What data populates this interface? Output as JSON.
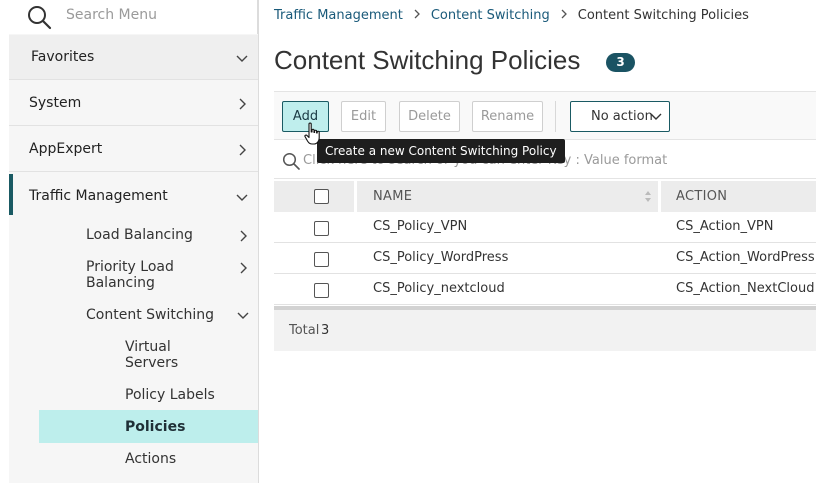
{
  "sidebar": {
    "search_placeholder": "Search Menu",
    "items": {
      "favorites": "Favorites",
      "system": "System",
      "appexpert": "AppExpert",
      "traffic_management": "Traffic Management"
    },
    "traffic_management_children": {
      "load_balancing": "Load Balancing",
      "priority_load_balancing": "Priority Load Balancing",
      "content_switching": "Content Switching"
    },
    "content_switching_children": {
      "virtual_servers": "Virtual Servers",
      "policy_labels": "Policy Labels",
      "policies": "Policies",
      "actions": "Actions"
    },
    "selected": "Policies"
  },
  "breadcrumb": {
    "items": [
      "Traffic Management",
      "Content Switching",
      "Content Switching Policies"
    ]
  },
  "page": {
    "title": "Content Switching Policies",
    "count": "3"
  },
  "toolbar": {
    "add": "Add",
    "edit": "Edit",
    "delete": "Delete",
    "rename": "Rename",
    "action_select": "No action"
  },
  "tooltip": "Create a new Content Switching Policy",
  "filter": {
    "placeholder": "Click here to search or you can enter Key : Value format"
  },
  "table": {
    "columns": [
      "NAME",
      "ACTION"
    ],
    "rows": [
      {
        "name": "CS_Policy_VPN",
        "action": "CS_Action_VPN"
      },
      {
        "name": "CS_Policy_WordPress",
        "action": "CS_Action_WordPress"
      },
      {
        "name": "CS_Policy_nextcloud",
        "action": "CS_Action_NextCloud"
      }
    ]
  },
  "footer": {
    "total_label": "Total",
    "total_value": "3"
  },
  "colors": {
    "accent": "#1a5a63",
    "selected_bg": "#bdeeec",
    "link": "#1a5a7a"
  },
  "icons": {
    "search": "search-icon",
    "chevron_down": "chevron-down-icon",
    "chevron_right": "chevron-right-icon",
    "sort": "sort-icon",
    "cursor": "hand-pointer-icon"
  }
}
